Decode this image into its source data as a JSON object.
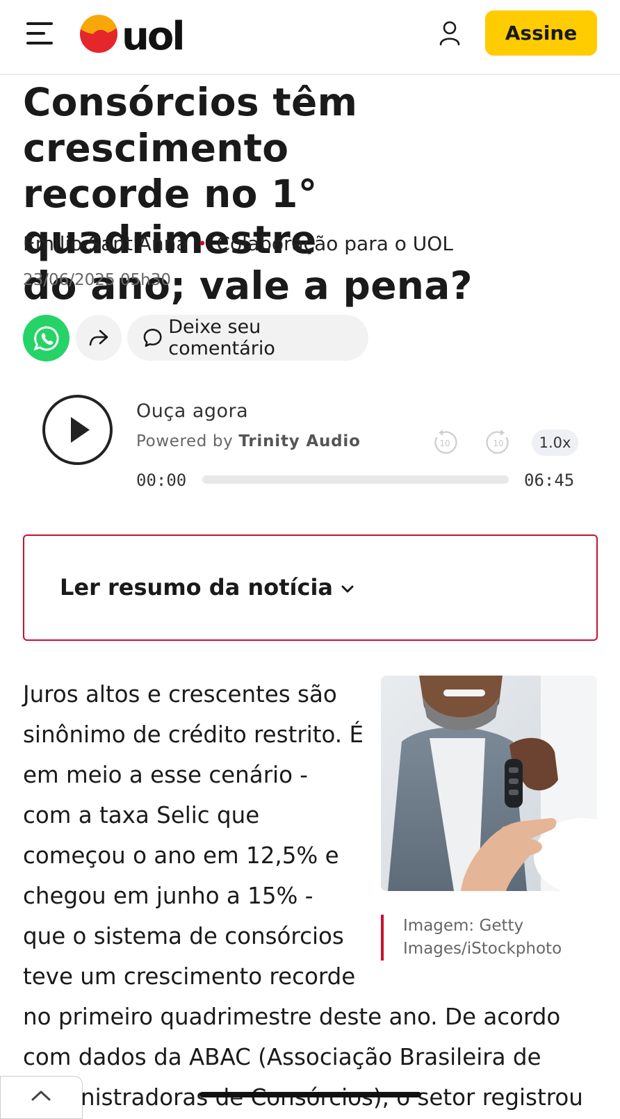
{
  "header": {
    "logo_text": "uol",
    "subscribe_label": "Assine"
  },
  "article": {
    "title_lines": [
      "Consórcios têm crescimento",
      "recorde no 1° quadrimestre",
      "do ano; vale a pena?"
    ],
    "author": "Emilio Sant'Anna",
    "byline_separator": "•",
    "collaboration": "Colaboração para o UOL",
    "date": "23/06/2025 05h30",
    "comment_label": "Deixe seu comentário",
    "image_caption": "Imagem: Getty Images/iStockphoto",
    "body_lines": [
      "Juros altos e crescentes são",
      "sinônimo de crédito restrito. É",
      "em meio a esse cenário -",
      "com a taxa Selic que",
      "começou o ano em 12,5% e",
      "chegou em junho a 15% -",
      "que o sistema de consórcios",
      "teve um crescimento recorde",
      "no primeiro quadrimestre deste ano. De acordo",
      "com dados da ABAC (Associação Brasileira de",
      "Administradoras de Consórcios), o setor registrou"
    ]
  },
  "audio": {
    "title": "Ouça agora",
    "powered_by": "Powered by",
    "provider": "Trinity Audio",
    "rewind_seconds": "10",
    "forward_seconds": "10",
    "speed": "1.0x",
    "current_time": "00:00",
    "duration": "06:45",
    "progress": 0
  },
  "summary": {
    "label": "Ler resumo da notícia"
  },
  "colors": {
    "brand_yellow": "#ffcc00",
    "accent_red": "#c8102e",
    "whatsapp_green": "#25d366"
  }
}
